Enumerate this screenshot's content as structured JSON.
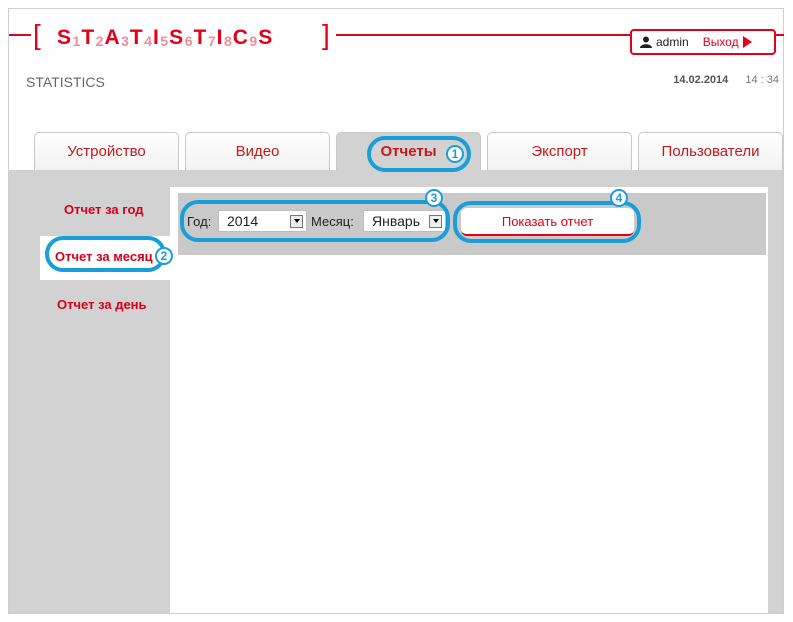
{
  "header": {
    "logo": [
      {
        "t": "S",
        "k": "L"
      },
      {
        "t": "1",
        "k": "D"
      },
      {
        "t": "T",
        "k": "L"
      },
      {
        "t": "2",
        "k": "D"
      },
      {
        "t": "A",
        "k": "L"
      },
      {
        "t": "3",
        "k": "D"
      },
      {
        "t": "T",
        "k": "L"
      },
      {
        "t": "4",
        "k": "D"
      },
      {
        "t": "I",
        "k": "L"
      },
      {
        "t": "5",
        "k": "D"
      },
      {
        "t": "S",
        "k": "L"
      },
      {
        "t": "6",
        "k": "D"
      },
      {
        "t": "T",
        "k": "L"
      },
      {
        "t": "7",
        "k": "D"
      },
      {
        "t": "I",
        "k": "L"
      },
      {
        "t": "8",
        "k": "D"
      },
      {
        "t": "C",
        "k": "L"
      },
      {
        "t": "9",
        "k": "D"
      },
      {
        "t": "S",
        "k": "L"
      }
    ],
    "subtitle": "STATISTICS",
    "username": "admin",
    "logout": "Выход",
    "date": "14.02.2014",
    "time": "14 : 34",
    "user_icon": "user-icon",
    "accent": "#e2001a"
  },
  "tabs": [
    {
      "label": "Устройство",
      "active": false
    },
    {
      "label": "Видео",
      "active": false
    },
    {
      "label": "Отчеты",
      "active": true
    },
    {
      "label": "Экспорт",
      "active": false
    },
    {
      "label": "Пользователи",
      "active": false
    }
  ],
  "sidebar": {
    "items": [
      {
        "label": "Отчет за год"
      },
      {
        "label": "Отчет за месяц"
      },
      {
        "label": "Отчет за день"
      }
    ]
  },
  "filter": {
    "year_label": "Год:",
    "year_value": "2014",
    "month_label": "Месяц:",
    "month_value": "Январь",
    "show_button": "Показать отчет"
  },
  "annotations": [
    "1",
    "2",
    "3",
    "4"
  ],
  "highlight_color": "#1a9ed8"
}
